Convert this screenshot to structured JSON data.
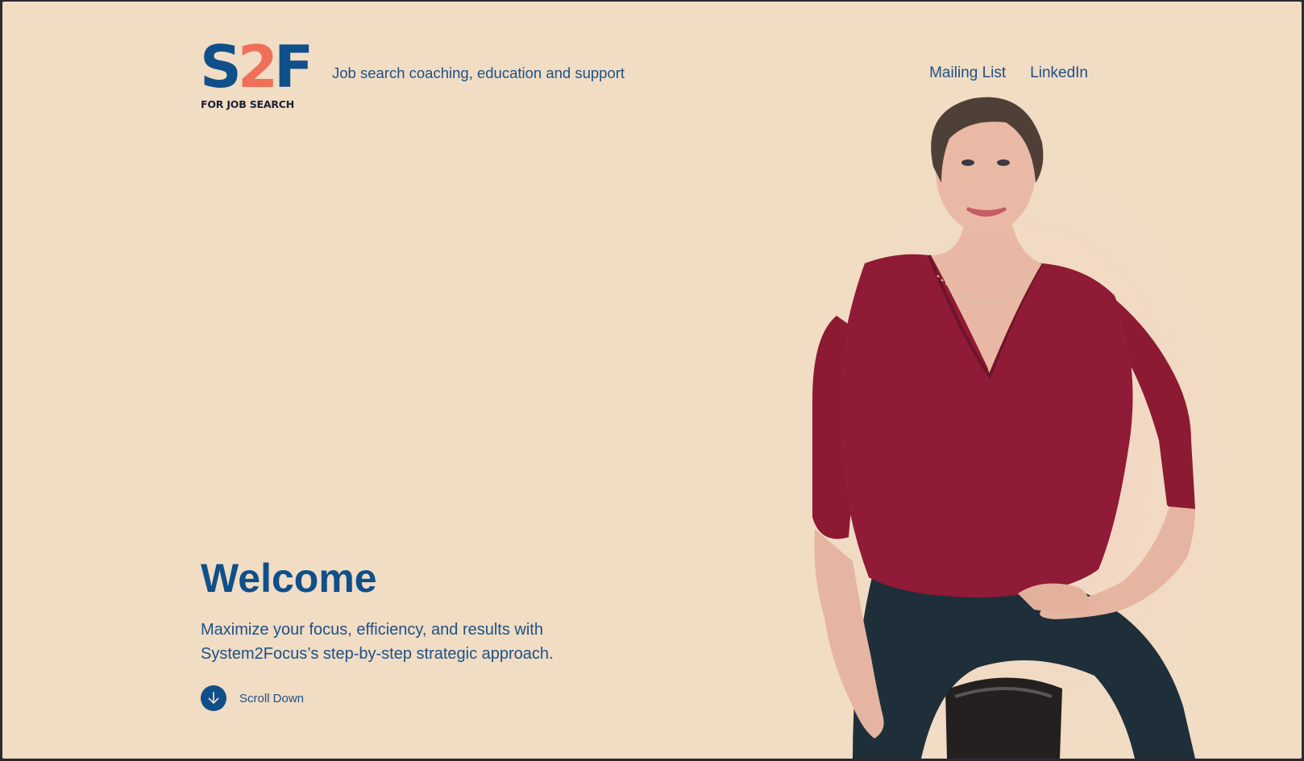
{
  "brand": {
    "logo_s": "S",
    "logo_2": "2",
    "logo_f": "F",
    "logo_subtitle": "FOR JOB SEARCH",
    "tagline": "Job search coaching, education and support",
    "colors": {
      "navy": "#0f4f8a",
      "coral": "#ef6f58",
      "background": "#f1dcc4",
      "text": "#1d5187"
    }
  },
  "nav": {
    "items": [
      {
        "label": "Mailing List"
      },
      {
        "label": "LinkedIn"
      }
    ]
  },
  "hero": {
    "title": "Welcome",
    "intro_line1": "Maximize your focus, efficiency, and results with",
    "intro_line2": "System2Focus’s step-by-step strategic approach.",
    "scroll_label": "Scroll Down",
    "scroll_icon": "arrow-down-icon",
    "photo_icon": "portrait-photo"
  }
}
